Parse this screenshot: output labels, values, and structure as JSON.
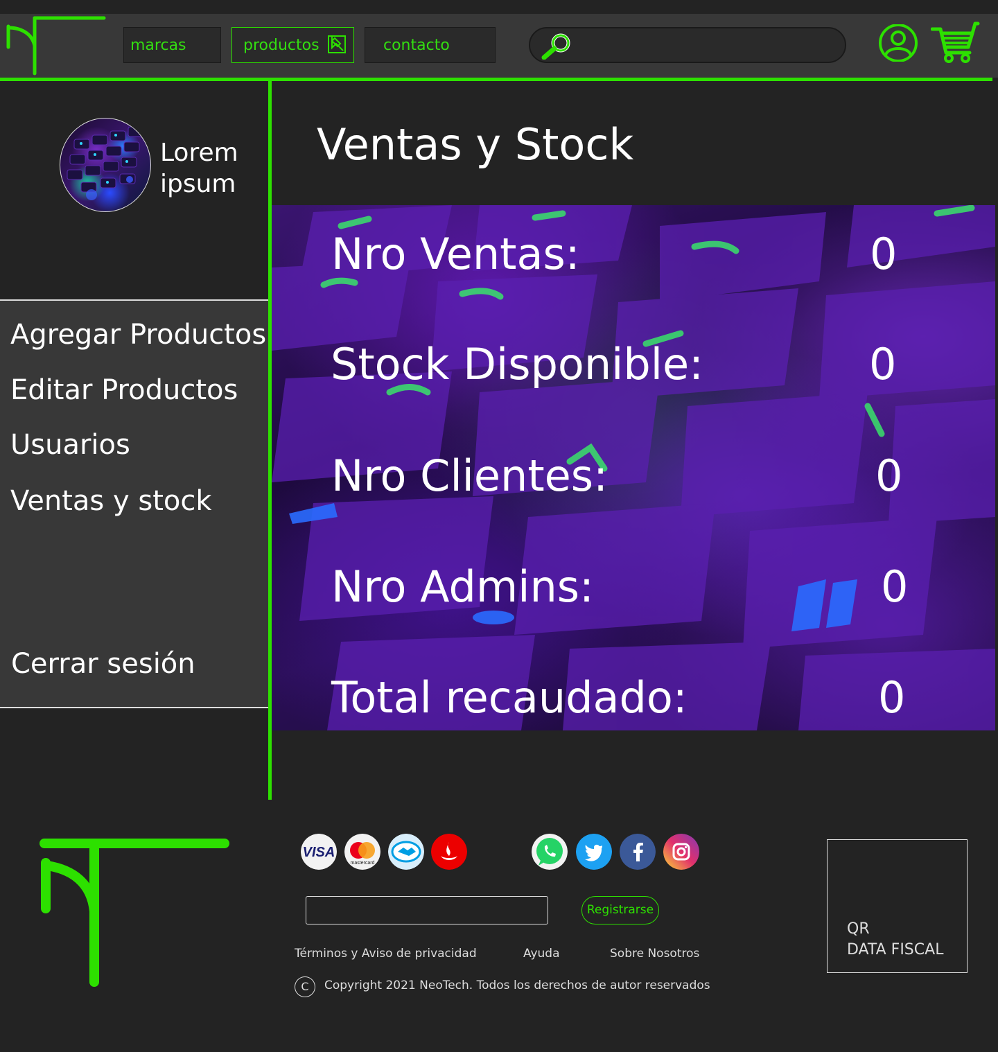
{
  "header": {
    "nav": [
      {
        "label": "marcas"
      },
      {
        "label": "productos"
      },
      {
        "label": "contacto"
      }
    ],
    "search_placeholder": ""
  },
  "sidebar": {
    "profile_name": "Lorem ipsum",
    "menu": [
      {
        "label": "Agregar Productos"
      },
      {
        "label": "Editar Productos"
      },
      {
        "label": "Usuarios"
      },
      {
        "label": "Ventas y stock"
      }
    ],
    "logout": "Cerrar sesión"
  },
  "main": {
    "title": "Ventas y Stock",
    "stats": [
      {
        "label": "Nro Ventas:",
        "value": "0"
      },
      {
        "label": "Stock Disponible:",
        "value": "0"
      },
      {
        "label": "Nro Clientes:",
        "value": "0"
      },
      {
        "label": "Nro Admins:",
        "value": "0"
      },
      {
        "label": "Total recaudado:",
        "value": "0"
      }
    ]
  },
  "footer": {
    "payment_icons": [
      "visa-icon",
      "mastercard-icon",
      "mercadopago-icon",
      "santander-icon"
    ],
    "social_icons": [
      "whatsapp-icon",
      "twitter-icon",
      "facebook-icon",
      "instagram-icon"
    ],
    "email_placeholder": "",
    "register_label": "Registrarse",
    "links": [
      "Términos y Aviso de privacidad",
      "Ayuda",
      "Sobre Nosotros"
    ],
    "copyright_symbol": "C",
    "copyright": "Copyright 2021 NeoTech. Todos los derechos de autor reservados",
    "qr_line1": "QR",
    "qr_line2": "DATA FISCAL"
  },
  "colors": {
    "accent": "#2de000",
    "background": "#232323",
    "panel": "#383838"
  }
}
